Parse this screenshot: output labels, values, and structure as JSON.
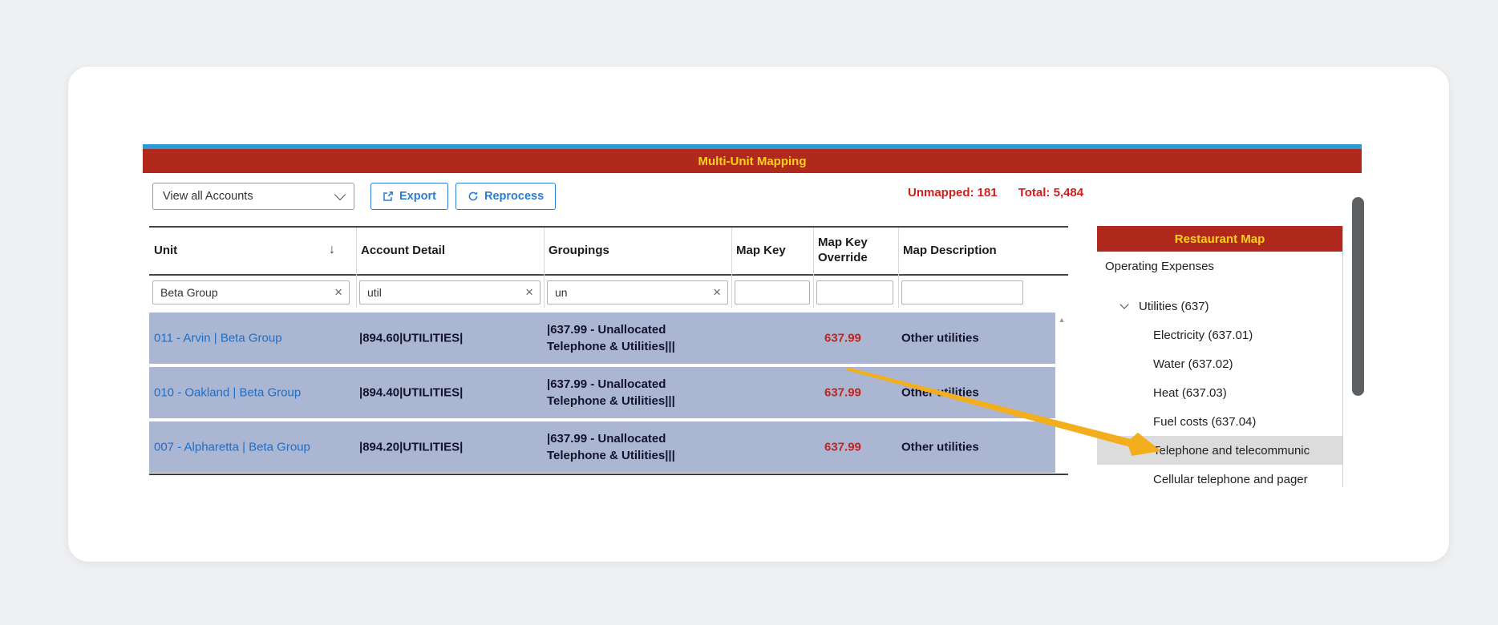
{
  "colors": {
    "accent_red": "#b1281d",
    "title_gold": "#ffd21e",
    "row_highlight": "#abb6d3",
    "link_blue": "#1b6fc9",
    "value_red": "#c3251c",
    "button_blue": "#2b7cd3",
    "arrow_gold": "#f2ae1c",
    "top_strip_blue": "#2a9ad4"
  },
  "icons": {
    "sort_desc": "↓",
    "clear": "×",
    "scroll_up": "▲"
  },
  "window": {
    "title": "Multi-Unit Mapping"
  },
  "toolbar": {
    "view_selector": "View all Accounts",
    "export_label": "Export",
    "reprocess_label": "Reprocess",
    "unmapped": "Unmapped: 181",
    "total": "Total: 5,484"
  },
  "table": {
    "columns": {
      "unit": "Unit",
      "account_detail": "Account Detail",
      "groupings": "Groupings",
      "map_key": "Map Key",
      "map_key_override": "Map Key Override",
      "map_description": "Map Description"
    },
    "filters": {
      "unit": "Beta Group",
      "account_detail": "util",
      "groupings": "un",
      "map_key": "",
      "map_key_override": "",
      "map_description": ""
    },
    "rows": [
      {
        "unit": "011 - Arvin | Beta Group",
        "account_detail": "|894.60|UTILITIES|",
        "groupings": "|637.99 - Unallocated Telephone & Utilities|||",
        "map_key": "",
        "map_key_override": "637.99",
        "map_description": "Other utilities"
      },
      {
        "unit": "010 - Oakland | Beta Group",
        "account_detail": "|894.40|UTILITIES|",
        "groupings": "|637.99 - Unallocated Telephone & Utilities|||",
        "map_key": "",
        "map_key_override": "637.99",
        "map_description": "Other utilities"
      },
      {
        "unit": "007 - Alpharetta | Beta Group",
        "account_detail": "|894.20|UTILITIES|",
        "groupings": "|637.99 - Unallocated Telephone & Utilities|||",
        "map_key": "",
        "map_key_override": "637.99",
        "map_description": "Other utilities"
      }
    ]
  },
  "map_panel": {
    "title": "Restaurant Map",
    "section": "Operating Expenses",
    "tree": [
      {
        "label": "Utilities (637)",
        "level": 0,
        "expanded": true
      },
      {
        "label": "Electricity (637.01)",
        "level": 1
      },
      {
        "label": "Water (637.02)",
        "level": 1
      },
      {
        "label": "Heat (637.03)",
        "level": 1
      },
      {
        "label": "Fuel costs (637.04)",
        "level": 1
      },
      {
        "label": "Telephone and telecommunic",
        "level": 1,
        "selected": true
      },
      {
        "label": "Cellular telephone and pager",
        "level": 1
      }
    ]
  }
}
